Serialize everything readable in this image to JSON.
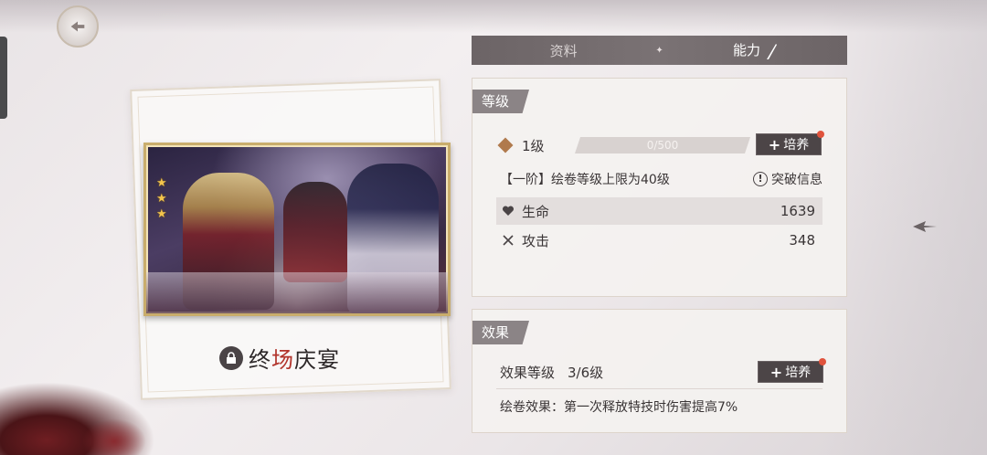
{
  "tabs": {
    "items": [
      "资料",
      "能力"
    ],
    "active": 1
  },
  "card": {
    "title_part1": "终",
    "title_accent": "场",
    "title_part2": "庆宴",
    "stars": 3
  },
  "level_panel": {
    "tag": "等级",
    "level": "1级",
    "exp_text": "0/500",
    "exp_progress": 0,
    "train_label": "培养",
    "stage_text": "【一阶】绘卷等级上限为40级",
    "break_label": "突破信息",
    "stats": [
      {
        "label": "生命",
        "value": "1639",
        "icon": "heart-icon"
      },
      {
        "label": "攻击",
        "value": "348",
        "icon": "crossed-swords-icon"
      }
    ]
  },
  "effect_panel": {
    "tag": "效果",
    "level_label": "效果等级",
    "level_value": "3/6级",
    "train_label": "培养",
    "desc": "绘卷效果：第一次释放特技时伤害提高7%"
  },
  "colors": {
    "accent": "#b2342c",
    "dark_button": "#4c4547",
    "notify_dot": "#e0533c"
  }
}
